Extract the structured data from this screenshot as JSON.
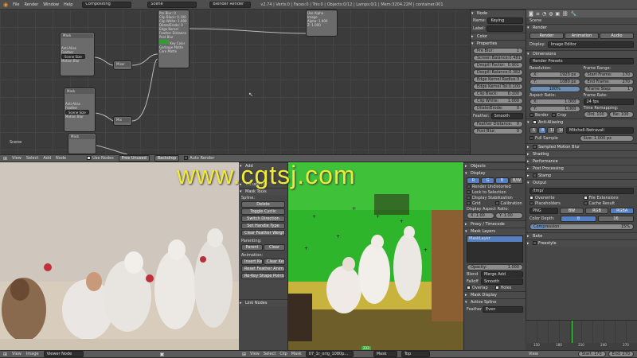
{
  "menubar": {
    "items": [
      "File",
      "Render",
      "Window",
      "Help"
    ],
    "editor_type": "Compositing",
    "scene": "Scene",
    "engine": "Blender Render",
    "stats": "v2.74 | Verts:0 | Faces:0 | Tris:0 | Objects:0/12 | Lamps:0/1 | Mem:3204.22M | container.001"
  },
  "node_editor": {
    "label": "Scene",
    "nodes": [
      {
        "title": "Mask",
        "rows": [
          "Anti-Alias",
          "Feather",
          "Scene Size",
          "Motion Blur"
        ]
      },
      {
        "title": "Mask",
        "rows": [
          "Anti-Alias",
          "Feather",
          "Scene Size",
          "Motion Blur"
        ]
      },
      {
        "title": "Mixer",
        "rows": [
          "Mix",
          "Alpha"
        ]
      },
      {
        "title": "Keying",
        "rows": [
          "Pre Blur: 0",
          "Clip Black: 0.100",
          "Clip White: 1.000",
          "Dilate/Erode: 0",
          "Edge Kernel",
          "Feather Distance",
          "Post Blur",
          "Image",
          "Key Color",
          "Garbage Matte",
          "Core Matte"
        ]
      },
      {
        "title": "Composite",
        "rows": [
          "Use Alpha",
          "Image",
          "Alpha: 1.000",
          "Z: 1.000"
        ]
      }
    ],
    "header": {
      "view": "View",
      "select": "Select",
      "add": "Add",
      "node": "Node",
      "use_nodes": "Use Nodes",
      "free_unused": "Free Unused",
      "backdrop": "Backdrop",
      "auto_render": "Auto Render"
    }
  },
  "node_panel": {
    "node_header": "Node",
    "name_label": "Name:",
    "name_value": "Keying",
    "label_label": "Label:",
    "label_value": "",
    "color_header": "Color",
    "properties_header": "Properties",
    "props": [
      {
        "label": "Pre Blur:",
        "value": "1"
      },
      {
        "label": "Screen Balance:",
        "value": "0.481"
      },
      {
        "label": "Despill Factor:",
        "value": "0.901"
      },
      {
        "label": "Despill Balance:",
        "value": "0.382"
      },
      {
        "label": "Edge Kernel Radius:",
        "value": "3"
      },
      {
        "label": "Edge Kernel Tol:",
        "value": "0.100"
      },
      {
        "label": "Clip Black:",
        "value": "0.100"
      },
      {
        "label": "Clip White:",
        "value": "1.000"
      },
      {
        "label": "Dilate/Erode:",
        "value": "0"
      }
    ],
    "feather_label": "Feather:",
    "feather_value": "Smooth",
    "feather_distance": "Feather Distance:",
    "feather_distance_value": "0",
    "post_blur": "Post Blur:",
    "post_blur_value": "0"
  },
  "properties": {
    "scene": "Scene",
    "render_header": "Render",
    "render_tabs": [
      "Render",
      "Animation",
      "Audio"
    ],
    "display_label": "Display:",
    "display_value": "Image Editor",
    "dimensions_header": "Dimensions",
    "presets": "Render Presets",
    "resolution_label": "Resolution:",
    "res_x": "1920 px",
    "res_y": "1080 px",
    "res_pct": "100%",
    "frame_range_label": "Frame Range:",
    "start_frame": "Start Frame:",
    "start_frame_value": "170",
    "end_frame": "End Frame:",
    "end_frame_value": "270",
    "frame_step": "Frame Step:",
    "frame_step_value": "1",
    "aspect_label": "Aspect Ratio:",
    "aspect_x": "1.000",
    "aspect_y": "1.000",
    "frame_rate_label": "Frame Rate:",
    "frame_rate_value": "24 fps",
    "time_remap": "Time Remapping:",
    "old": "Old: 100",
    "new": "Ne: 100",
    "border": "Border",
    "crop": "Crop",
    "aa_header": "Anti-Aliasing",
    "aa_samples": [
      "5",
      "8",
      "11",
      "16"
    ],
    "aa_filter": "Mitchell-Netravali",
    "full_sample": "Full Sample",
    "size": "Size: 1.000 px",
    "sampled_mb": "Sampled Motion Blur",
    "shading": "Shading",
    "performance": "Performance",
    "post_processing": "Post Processing",
    "stamp": "Stamp",
    "output_header": "Output",
    "output_path": "/tmp/",
    "overwrite": "Overwrite",
    "file_ext": "File Extensions",
    "placeholders": "Placeholders",
    "cache_result": "Cache Result",
    "format": "PNG",
    "bw": "BW",
    "rgb": "RGB",
    "rgba": "RGBA",
    "color_depth": "Color Depth:",
    "depth_8": "8",
    "depth_16": "16",
    "compression": "Compression:",
    "compression_value": "15%",
    "bake": "Bake",
    "freestyle": "Freestyle"
  },
  "viewer_header": {
    "view": "View",
    "image": "Image",
    "mode": "Viewer Node"
  },
  "mask_tools": {
    "header": "Add",
    "transform": "Transform",
    "mask_tools_header": "Mask Tools",
    "spline_label": "Spline:",
    "spline_buttons": [
      "Delete",
      "Toggle Cyclic",
      "Switch Direction",
      "Set Handle Type",
      "Clear Feather Weight"
    ],
    "parenting_label": "Parenting:",
    "parent": "Parent",
    "clear": "Clear",
    "animation_label": "Animation:",
    "insert_key": "Insert Key",
    "clear_key": "Clear Key",
    "reset_feather": "Reset Feather Anim...",
    "re_key": "Re-Key Shape Points",
    "link_nodes": "Link Nodes"
  },
  "clip_panel": {
    "objects": "Objects",
    "display_header": "Display",
    "channels": [
      "R",
      "G",
      "B",
      "B/W"
    ],
    "render_undistorted": "Render Undistorted",
    "lock_selection": "Lock to Selection",
    "display_stabilization": "Display Stabilization",
    "grid": "Grid",
    "calibration": "Calibration",
    "display_aspect": "Display Aspect Ratio:",
    "asp_x": "X: 1.00",
    "asp_y": "Y: 1.00",
    "proxy": "Proxy / Timecode",
    "mask_layers": "Mask Layers",
    "mask_layer_item": "MaskLayer",
    "opacity": "Opacity:",
    "opacity_value": "1.000",
    "blend": "Blend",
    "blend_value": "Merge Add",
    "falloff": "Falloff",
    "falloff_value": "Smooth",
    "overlap": "Overlap",
    "holes": "Holes",
    "mask_display": "Mask Display",
    "active_spline": "Active Spline",
    "feather": "Feather",
    "feather_value": "Even"
  },
  "clip_header": {
    "view": "View",
    "select": "Select",
    "clip": "Clip",
    "mask": "Mask",
    "clip_name": "07_1r_orig_1080p...",
    "mask_mode": "Mask",
    "top": "Top",
    "frame": "233"
  },
  "timeline": {
    "start": "Start:",
    "start_value": "170",
    "end": "End:",
    "end_value": "270",
    "ticks": [
      "150",
      "180",
      "210",
      "240",
      "270"
    ]
  },
  "watermark": "www.cgtsj.com"
}
